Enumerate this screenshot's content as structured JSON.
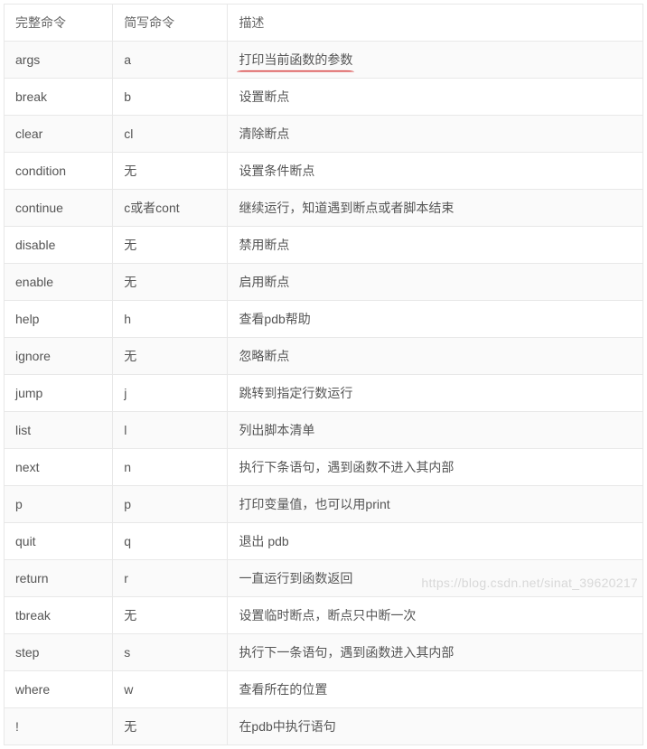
{
  "headers": {
    "full": "完整命令",
    "short": "简写命令",
    "desc": "描述"
  },
  "rows": [
    {
      "full": "args",
      "short": "a",
      "desc": "打印当前函数的参数",
      "highlighted": true
    },
    {
      "full": "break",
      "short": "b",
      "desc": "设置断点"
    },
    {
      "full": "clear",
      "short": "cl",
      "desc": "清除断点"
    },
    {
      "full": "condition",
      "short": "无",
      "desc": "设置条件断点"
    },
    {
      "full": "continue",
      "short": "c或者cont",
      "desc": "继续运行，知道遇到断点或者脚本结束"
    },
    {
      "full": "disable",
      "short": "无",
      "desc": "禁用断点"
    },
    {
      "full": "enable",
      "short": "无",
      "desc": "启用断点"
    },
    {
      "full": "help",
      "short": "h",
      "desc": "查看pdb帮助"
    },
    {
      "full": "ignore",
      "short": "无",
      "desc": "忽略断点"
    },
    {
      "full": "jump",
      "short": "j",
      "desc": "跳转到指定行数运行"
    },
    {
      "full": "list",
      "short": "l",
      "desc": "列出脚本清单"
    },
    {
      "full": "next",
      "short": "n",
      "desc": "执行下条语句，遇到函数不进入其内部"
    },
    {
      "full": "p",
      "short": "p",
      "desc": "打印变量值，也可以用print"
    },
    {
      "full": "quit",
      "short": "q",
      "desc": "退出 pdb"
    },
    {
      "full": "return",
      "short": "r",
      "desc": "一直运行到函数返回"
    },
    {
      "full": "tbreak",
      "short": "无",
      "desc": "设置临时断点，断点只中断一次"
    },
    {
      "full": "step",
      "short": "s",
      "desc": "执行下一条语句，遇到函数进入其内部"
    },
    {
      "full": "where",
      "short": "w",
      "desc": "查看所在的位置"
    },
    {
      "full": "!",
      "short": "无",
      "desc": "在pdb中执行语句"
    }
  ],
  "watermark": "https://blog.csdn.net/sinat_39620217"
}
